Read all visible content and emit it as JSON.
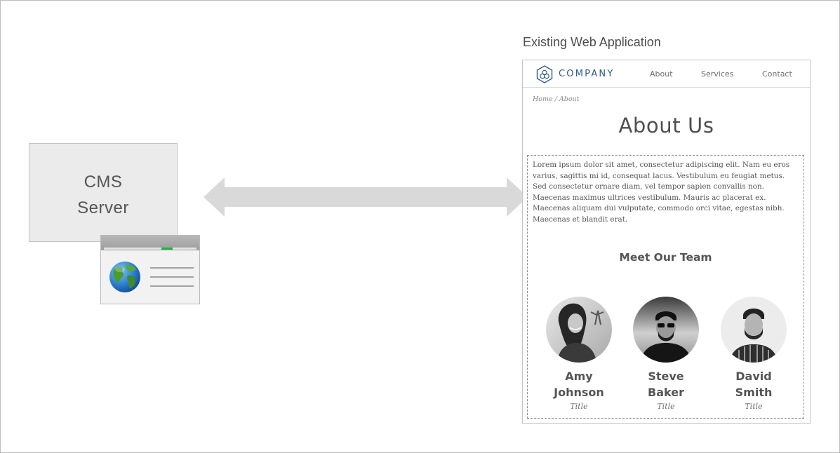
{
  "cms": {
    "label_line1": "CMS",
    "label_line2": "Server"
  },
  "browser_icon": {
    "icon": "globe-icon",
    "progress_color": "#20b24a"
  },
  "arrow": {
    "type": "bidirectional",
    "color": "#d9d9d9"
  },
  "web_app": {
    "caption": "Existing Web Application",
    "nav": {
      "logo_text": "COMPANY",
      "logo_color": "#2f5b8c",
      "links": [
        "About",
        "Services",
        "Contact"
      ]
    },
    "breadcrumb": "Home / About",
    "page_title": "About Us",
    "body_text": "Lorem ipsum dolor sit amet, consectetur adipiscing elit. Nam eu eros varius, sagittis mi id, consequat lacus. Vestibulum eu feugiat metus. Sed consectetur ornare diam, vel tempor sapien convallis non. Maecenas maximus ultrices vestibulum. Mauris ac placerat ex. Maecenas aliquam dui vulputate, commodo orci vitae, egestas nibh. Maecenas et blandit erat.",
    "team_heading": "Meet Our Team",
    "team": [
      {
        "name": "Amy Johnson",
        "title": "Title"
      },
      {
        "name": "Steve Baker",
        "title": "Title"
      },
      {
        "name": "David Smith",
        "title": "Title"
      }
    ]
  }
}
